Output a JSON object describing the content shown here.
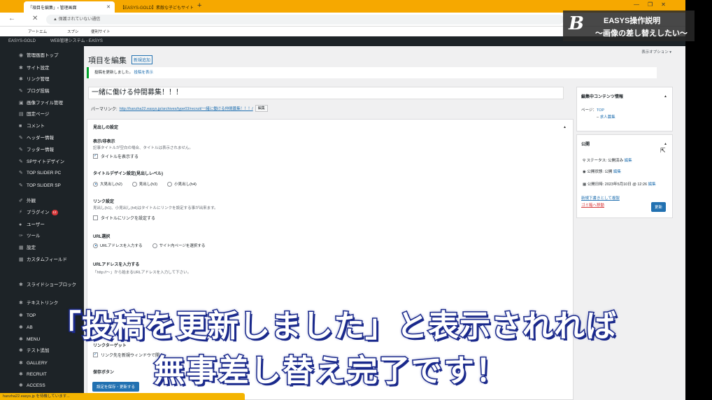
{
  "browser": {
    "tab1": "「項目を編集」‹ 管理画面",
    "tab2": "【EASYS-GOLD】素敵な子どもサイト",
    "new_tab": "+",
    "controls": [
      "—",
      "❐",
      "✕"
    ],
    "nav": [
      "←",
      "✕"
    ],
    "url": "保護されていない通信",
    "bookmarks": [
      "アートエム",
      "スプシ",
      "便利サイト"
    ]
  },
  "adminbar": {
    "site": "EASYS-GOLD",
    "system": "WEB管理システム - EASYS"
  },
  "sidebar": {
    "items": [
      {
        "label": "管理画面トップ",
        "icon": "gauge-icon"
      },
      {
        "label": "サイト設定",
        "icon": "gear-icon"
      },
      {
        "label": "リンク管理",
        "icon": "gear-icon"
      },
      {
        "label": "ブログ投稿",
        "icon": "pin-icon"
      },
      {
        "label": "画像ファイル管理",
        "icon": "media-icon"
      },
      {
        "label": "固定ページ",
        "icon": "page-icon"
      },
      {
        "label": "コメント",
        "icon": "comment-icon"
      },
      {
        "label": "ヘッダー情報",
        "icon": "pin-icon"
      },
      {
        "label": "フッター情報",
        "icon": "pin-icon"
      },
      {
        "label": "SPサイトデザイン",
        "icon": "pin-icon"
      },
      {
        "label": "TOP SLIDER PC",
        "icon": "pin-icon"
      },
      {
        "label": "TOP SLIDER SP",
        "icon": "pin-icon"
      },
      {
        "label": "外観",
        "icon": "brush-icon"
      },
      {
        "label": "プラグイン",
        "icon": "plugin-icon",
        "badge": "12"
      },
      {
        "label": "ユーザー",
        "icon": "user-icon"
      },
      {
        "label": "ツール",
        "icon": "wrench-icon"
      },
      {
        "label": "設定",
        "icon": "settings-icon"
      },
      {
        "label": "カスタムフィールド",
        "icon": "grid-icon"
      },
      {
        "label": "スライドショーブロック",
        "icon": "gear-icon"
      },
      {
        "label": "テキストリンク",
        "icon": "gear-icon"
      },
      {
        "label": "TOP",
        "icon": "gear-icon"
      },
      {
        "label": "AB",
        "icon": "gear-icon"
      },
      {
        "label": "MENU",
        "icon": "gear-icon"
      },
      {
        "label": "テスト追加",
        "icon": "gear-icon"
      },
      {
        "label": "GALLERY",
        "icon": "gear-icon"
      },
      {
        "label": "RECRUIT",
        "icon": "gear-icon"
      },
      {
        "label": "ACCESS",
        "icon": "gear-icon"
      }
    ]
  },
  "main": {
    "screen_options": "表示オプション ▾",
    "title": "項目を編集",
    "add_new": "新規追加",
    "notice": "投稿を更新しました。",
    "notice_link": "投稿を表示",
    "post_title": "一緒に働ける仲間募集！！！",
    "permalink_label": "パーマリンク:",
    "permalink_url": "http://hanzha22.easys.jp/archives/type03/recruit/一緒に働ける仲間募集！！！/",
    "permalink_edit": "編集",
    "metabox": {
      "heading": "見出しの設定",
      "show_label": "表示/非表示",
      "show_desc": "記事タイトルが空白の場合、タイトルは表示されません。",
      "show_checkbox": "タイトルを表示する",
      "design_label": "タイトルデザイン設定(見出しレベル)",
      "design_options": [
        "大見出し(h2)",
        "見出し(h3)",
        "小見出し(h4)"
      ],
      "link_label": "リンク設定",
      "link_desc": "見出し(h1)、小見出し(h4)はタイトルにリンクを設定する事が出来ます。",
      "link_checkbox": "タイトルにリンクを設定する",
      "url_select_label": "URL選択",
      "url_options": [
        "URLアドレスを入力する",
        "サイト内ページを選択する"
      ],
      "url_input_label": "URLアドレスを入力する",
      "url_input_desc": "「http://～」から始まるURLアドレスを入力して下さい。",
      "target_label": "リンクターゲット",
      "target_checkbox": "リンク先を新規ウィンドウで開く",
      "save_label": "保存ボタン",
      "save_button": "設定を保存・更新する"
    },
    "side_content": {
      "heading": "編集中コンテンツ情報",
      "page_label": "ページ：",
      "page_link": "TOP",
      "child_link": "求人募集"
    },
    "publish": {
      "heading": "公開",
      "status": "ステータス: 公開済み",
      "status_edit": "編集",
      "visibility": "公開状態: 公開",
      "visibility_edit": "編集",
      "date": "公開日時: 2023年5月10日 @ 12:26",
      "date_edit": "編集",
      "draft_link": "新規下書きとして複製",
      "trash_link": "ゴミ箱へ移動",
      "update": "更新"
    }
  },
  "status_bar": "hanzha22.easys.jp を待機しています...",
  "overlay": {
    "brand_name": "EASYS操作説明",
    "brand_sub": "〜画像の差し替えしたい〜",
    "caption1": "「投稿を更新しました」と表示されれば",
    "caption2": "無事差し替え完了です！"
  }
}
